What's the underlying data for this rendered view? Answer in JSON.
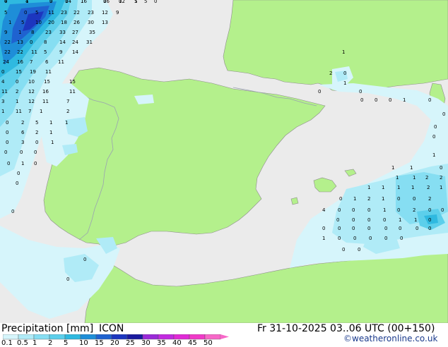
{
  "title": {
    "label": "Precipitation [mm]",
    "model": "ICON"
  },
  "valid_time": "Fr 31-10-2025 03..06 UTC (00+150)",
  "credit": "©weatheronline.co.uk",
  "colors": {
    "sea": "#ebebeb",
    "land": "#b4f08c",
    "border": "#9aa3b0",
    "coast": "#8c8c8c"
  },
  "legend": {
    "values": [
      "0.1",
      "0.5",
      "1",
      "2",
      "5",
      "10",
      "15",
      "20",
      "25",
      "30",
      "35",
      "40",
      "45",
      "50"
    ],
    "colors": [
      "#d6f5fb",
      "#b0ebf7",
      "#86def2",
      "#5ccfeb",
      "#2fb9e0",
      "#1e8ed8",
      "#1f62d0",
      "#1c36bf",
      "#1a1a9e",
      "#9a2ad8",
      "#c22ae0",
      "#e02ad6",
      "#f03ac8",
      "#f768c8"
    ]
  },
  "labels_nw": [
    "4",
    "4",
    "9",
    "14",
    "16",
    "16",
    "12",
    "5",
    "5",
    "0",
    "5",
    "0",
    "5",
    "11",
    "23",
    "22",
    "23",
    "12",
    "9",
    "1",
    "5",
    "10",
    "20",
    "18",
    "26",
    "30",
    "13",
    "9",
    "1",
    "8",
    "23",
    "33",
    "27",
    "35",
    "22",
    "13",
    "0",
    "8",
    "14",
    "24",
    "31",
    "22",
    "22",
    "11",
    "5",
    "9",
    "14",
    "24",
    "16",
    "7",
    "6",
    "11",
    "0",
    "15",
    "19",
    "11",
    "4",
    "0",
    "10",
    "15",
    "15",
    "11",
    "2",
    "12",
    "16",
    "11",
    "3",
    "1",
    "12",
    "11",
    "7",
    "1",
    "11",
    "7",
    "1",
    "2",
    "0",
    "2",
    "5",
    "1",
    "1",
    "0",
    "6",
    "2",
    "1",
    "0",
    "3",
    "0",
    "1",
    "0",
    "0",
    "0",
    "0",
    "1",
    "0",
    "0",
    "0",
    "0",
    "0",
    "0",
    "0",
    "1",
    "0",
    "0",
    "1",
    "0",
    "0",
    "1"
  ],
  "labels_e": [
    "1",
    "2",
    "0",
    "1",
    "0",
    "0",
    "0",
    "0",
    "0",
    "1",
    "0",
    "0",
    "0",
    "0",
    "1",
    "1",
    "1",
    "0",
    "1",
    "1",
    "2",
    "2",
    "1",
    "1",
    "1",
    "1",
    "2",
    "1",
    "0",
    "1",
    "2",
    "1",
    "0",
    "0",
    "2",
    "4",
    "0",
    "0",
    "0",
    "1",
    "0",
    "2",
    "0",
    "0",
    "0",
    "0",
    "0",
    "0",
    "1",
    "1",
    "0",
    "0",
    "0",
    "0",
    "0",
    "0",
    "0",
    "0",
    "0",
    "1",
    "0",
    "0",
    "0",
    "0",
    "0",
    "0",
    "0"
  ]
}
